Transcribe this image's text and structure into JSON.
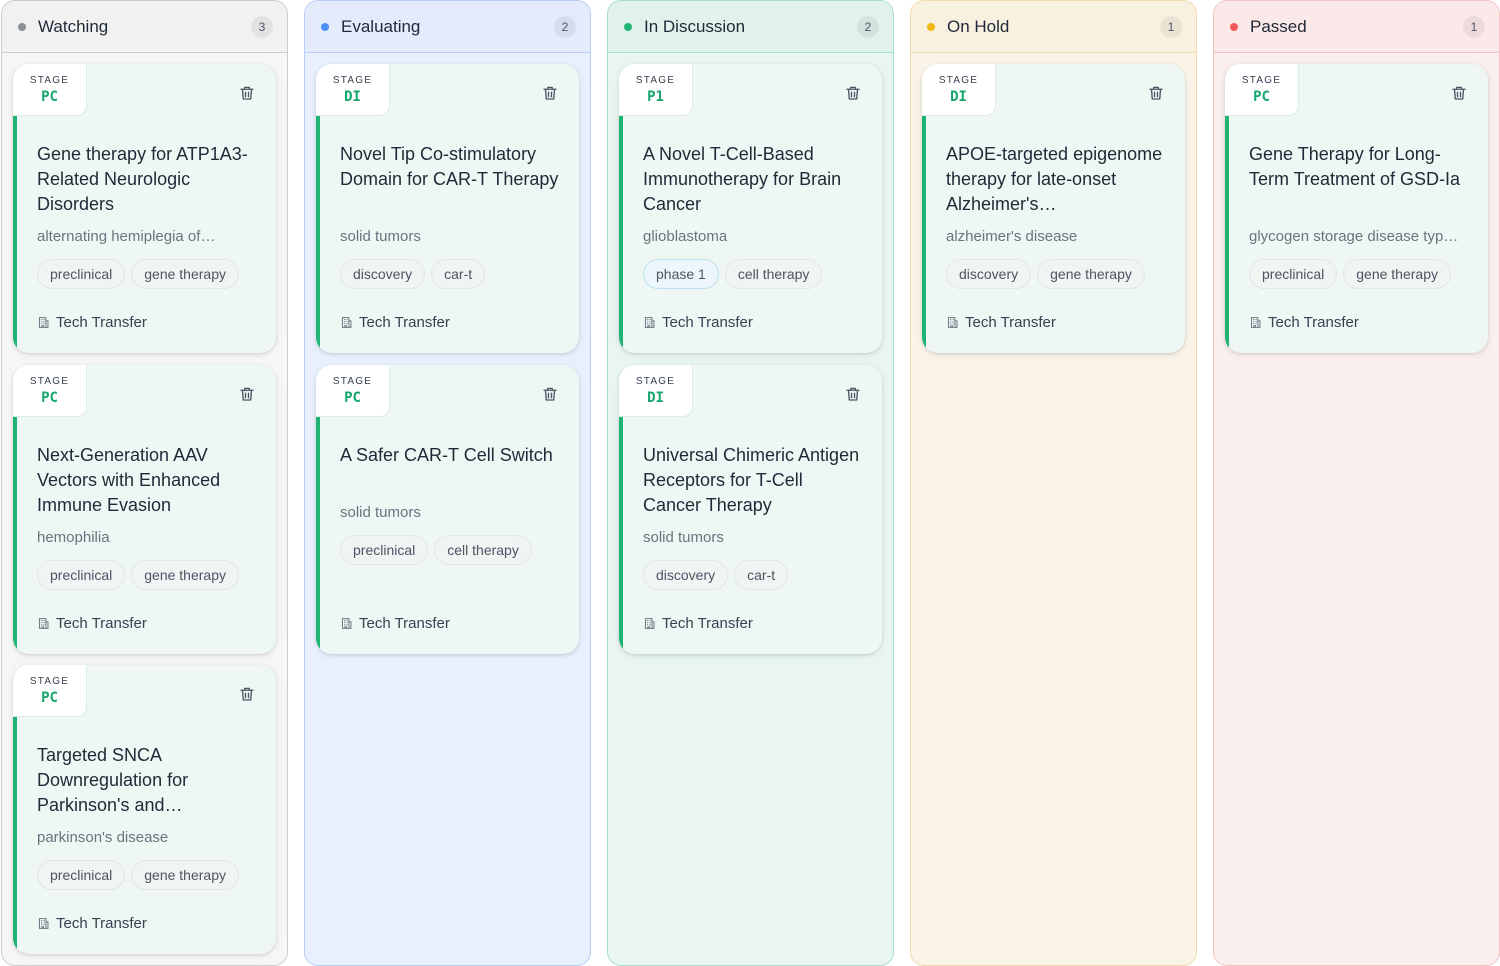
{
  "columns": [
    {
      "title": "Watching",
      "count": "3",
      "dot": "#8a8f96",
      "border": "#c9ccd0",
      "bg": "#f6f6f6",
      "header_bg": "#f1f1f2",
      "cards": [
        {
          "stage_label": "STAGE",
          "stage": "PC",
          "title": "Gene therapy for ATP1A3-Related Neurologic Disorders",
          "subtitle": "alternating hemiplegia of…",
          "tags": [
            "preclinical",
            "gene therapy"
          ],
          "footer": "Tech Transfer"
        },
        {
          "stage_label": "STAGE",
          "stage": "PC",
          "title": "Next-Generation AAV Vectors with Enhanced Immune Evasion",
          "subtitle": "hemophilia",
          "tags": [
            "preclinical",
            "gene therapy"
          ],
          "footer": "Tech Transfer"
        },
        {
          "stage_label": "STAGE",
          "stage": "PC",
          "title": "Targeted SNCA Downregulation for Parkinson's and…",
          "subtitle": "parkinson's disease",
          "tags": [
            "preclinical",
            "gene therapy"
          ],
          "footer": "Tech Transfer"
        }
      ]
    },
    {
      "title": "Evaluating",
      "count": "2",
      "dot": "#4d8ef7",
      "border": "#b7cdf3",
      "bg": "#e9f0fd",
      "header_bg": "#e3ebfc",
      "cards": [
        {
          "stage_label": "STAGE",
          "stage": "DI",
          "title": "Novel Tip Co-stimulatory Domain for CAR-T Therapy",
          "subtitle": "solid tumors",
          "tags": [
            "discovery",
            "car-t"
          ],
          "footer": "Tech Transfer"
        },
        {
          "stage_label": "STAGE",
          "stage": "PC",
          "title": "A Safer CAR-T Cell Switch",
          "subtitle": "solid tumors",
          "tags": [
            "preclinical",
            "cell therapy"
          ],
          "footer": "Tech Transfer"
        }
      ]
    },
    {
      "title": "In Discussion",
      "count": "2",
      "dot": "#1fb374",
      "border": "#a9dccb",
      "bg": "#e8f5f1",
      "header_bg": "#e0f2eb",
      "cards": [
        {
          "stage_label": "STAGE",
          "stage": "P1",
          "title": "A Novel T-Cell-Based Immunotherapy for Brain Cancer",
          "subtitle": "glioblastoma",
          "tags": [
            "phase 1",
            "cell therapy"
          ],
          "footer": "Tech Transfer"
        },
        {
          "stage_label": "STAGE",
          "stage": "DI",
          "title": "Universal Chimeric Antigen Receptors for T-Cell Cancer Therapy",
          "subtitle": "solid tumors",
          "tags": [
            "discovery",
            "car-t"
          ],
          "footer": "Tech Transfer"
        }
      ]
    },
    {
      "title": "On Hold",
      "count": "1",
      "dot": "#f3b514",
      "border": "#f1dcab",
      "bg": "#f9f3e8",
      "header_bg": "#f9f1e0",
      "cards": [
        {
          "stage_label": "STAGE",
          "stage": "DI",
          "title": "APOE-targeted epigenome therapy for late-onset Alzheimer's…",
          "subtitle": "alzheimer's disease",
          "tags": [
            "discovery",
            "gene therapy"
          ],
          "footer": "Tech Transfer"
        }
      ]
    },
    {
      "title": "Passed",
      "count": "1",
      "dot": "#ef5b5b",
      "border": "#f1c3c3",
      "bg": "#fbeeee",
      "header_bg": "#fbe8e8",
      "cards": [
        {
          "stage_label": "STAGE",
          "stage": "PC",
          "title": "Gene Therapy for Long-Term Treatment of GSD-Ia",
          "subtitle": "glycogen storage disease typ…",
          "tags": [
            "preclinical",
            "gene therapy"
          ],
          "footer": "Tech Transfer"
        }
      ]
    }
  ],
  "icons": {
    "delete": "trash-icon",
    "footer": "building-icon"
  },
  "accent": "#1fb374"
}
